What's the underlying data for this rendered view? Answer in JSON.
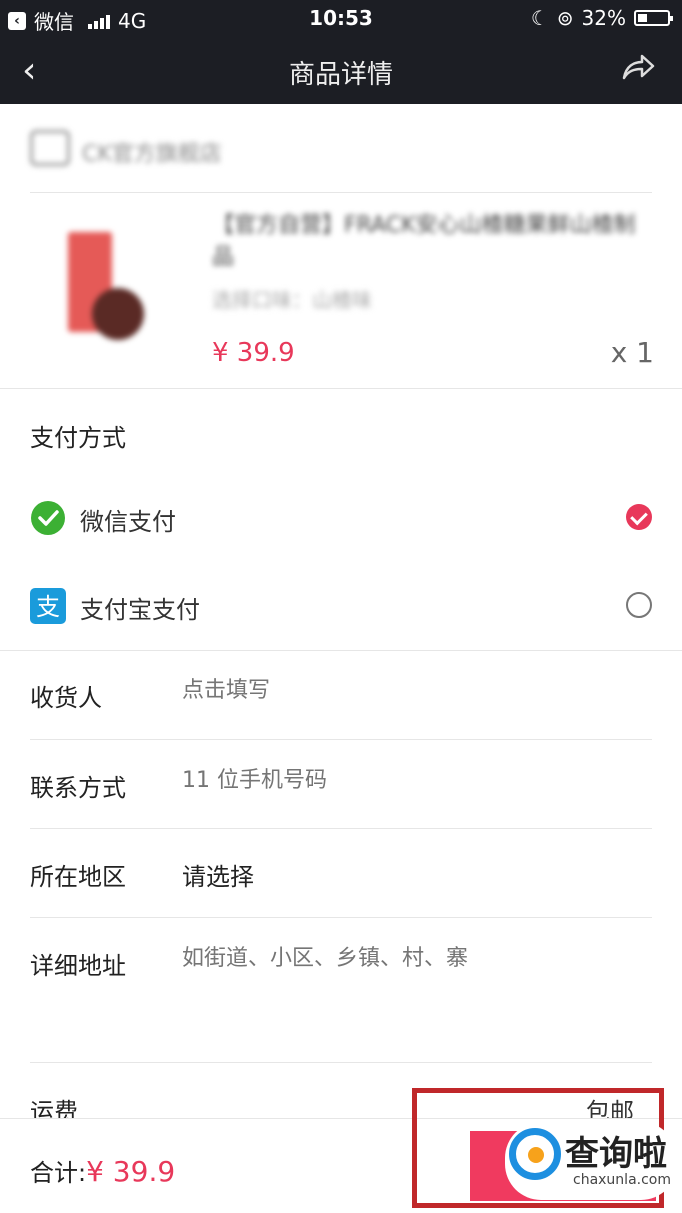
{
  "status_bar": {
    "app": "微信",
    "network": "4G",
    "time": "10:53",
    "battery": "32%",
    "battery_level": 0.32
  },
  "nav": {
    "title": "商品详情"
  },
  "shop": {
    "name": "CK官方旗舰店"
  },
  "product": {
    "title": "【官方自营】FRACK安心山楂糖果鲜山楂制品",
    "spec": "选择口味：山楂味",
    "price": "¥ 39.9",
    "quantity": "x 1"
  },
  "payment": {
    "section_title": "支付方式",
    "options": [
      {
        "label": "微信支付",
        "icon": "wechat-pay-icon",
        "selected": true
      },
      {
        "label": "支付宝支付",
        "icon": "alipay-icon",
        "selected": false
      }
    ]
  },
  "form": {
    "receiver": {
      "label": "收货人",
      "placeholder": "点击填写"
    },
    "phone": {
      "label": "联系方式",
      "placeholder": "11 位手机号码"
    },
    "region": {
      "label": "所在地区",
      "value": "请选择"
    },
    "address": {
      "label": "详细地址",
      "placeholder": "如街道、小区、乡镇、村、寨"
    }
  },
  "shipping": {
    "label": "运费",
    "value": "包邮"
  },
  "footer": {
    "total_label": "合计:",
    "total_amount": "¥ 39.9"
  },
  "watermark": {
    "text": "查询啦",
    "sub": "chaxunla.com"
  },
  "colors": {
    "accent": "#e8385a",
    "navbar": "#1c1e24",
    "wechat": "#3cb034",
    "alipay": "#1a9bdb",
    "highlight_frame": "#c0282a"
  }
}
